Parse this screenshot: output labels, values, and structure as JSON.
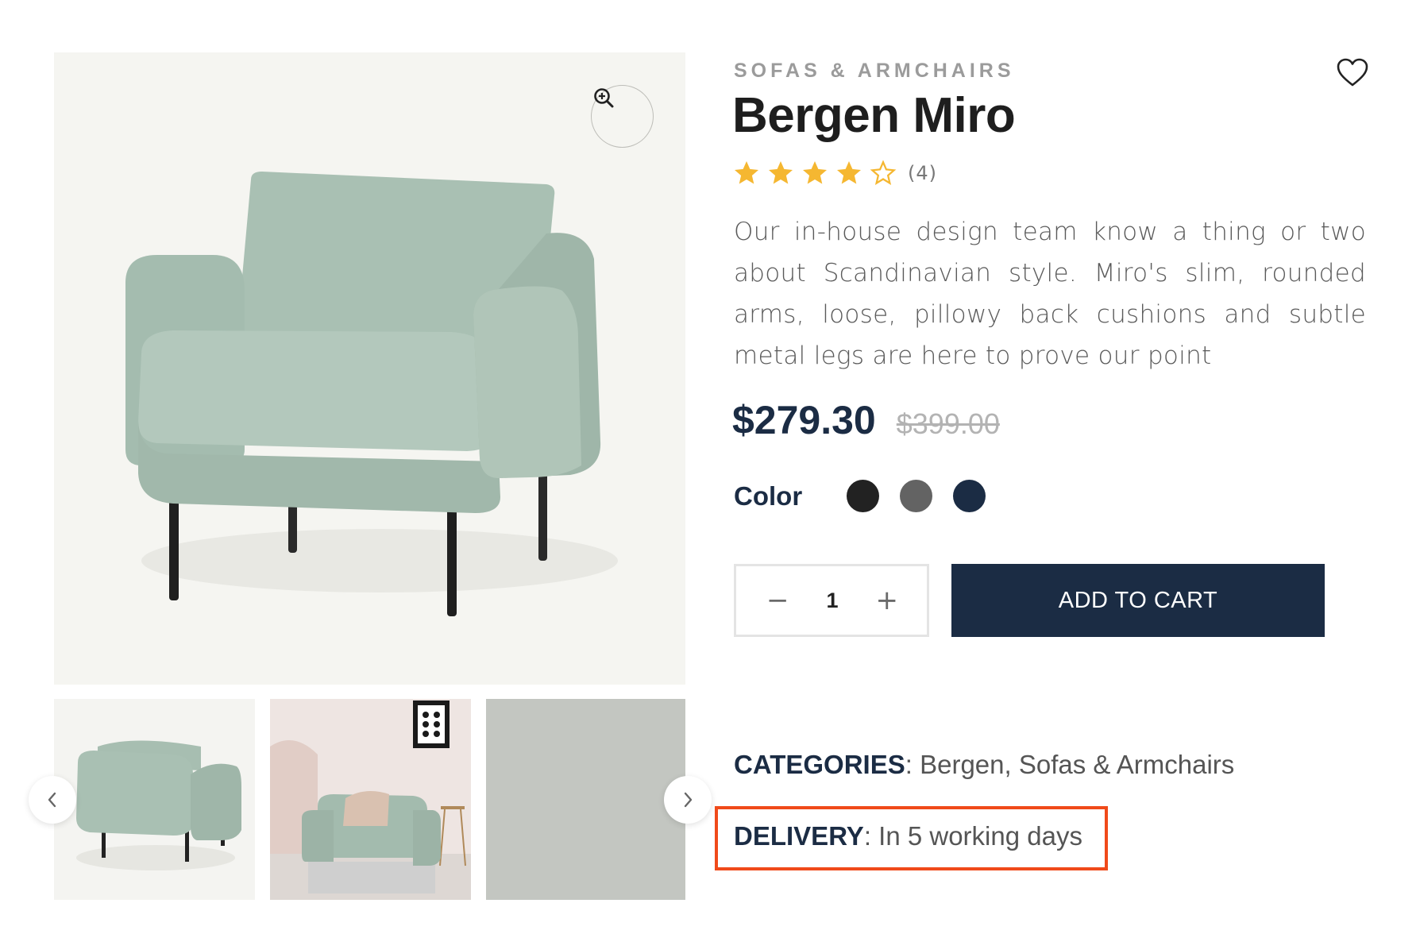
{
  "gallery": {
    "zoom_icon": "zoom-in-icon",
    "prev_icon": "chevron-left-icon",
    "next_icon": "chevron-right-icon"
  },
  "product": {
    "category": "SOFAS & ARMCHAIRS",
    "title": "Bergen Miro",
    "rating": {
      "stars": 4,
      "max_stars": 5,
      "count_label": "(4)"
    },
    "description": "Our in-house design team know a thing or two about Scandinavian style. Miro's slim, rounded arms, loose, pillowy back cushions and subtle metal legs are here to prove our point",
    "price": {
      "current": "$279.30",
      "original": "$399.00"
    },
    "color": {
      "label": "Color",
      "options": [
        {
          "name": "black",
          "hex": "#222222"
        },
        {
          "name": "grey",
          "hex": "#636363"
        },
        {
          "name": "navy",
          "hex": "#1b2c44"
        }
      ]
    },
    "quantity": {
      "value": "1",
      "decrement": "−",
      "increment": "+"
    },
    "add_to_cart_label": "ADD TO CART",
    "meta": {
      "categories_key": "CATEGORIES",
      "categories_value": ": Bergen, Sofas & Armchairs",
      "delivery_key": "DELIVERY",
      "delivery_value": ": In 5 working days"
    }
  },
  "theme": {
    "accent": "#1b2c44",
    "star_color": "#f5b731",
    "highlight": "#f04a1a"
  }
}
